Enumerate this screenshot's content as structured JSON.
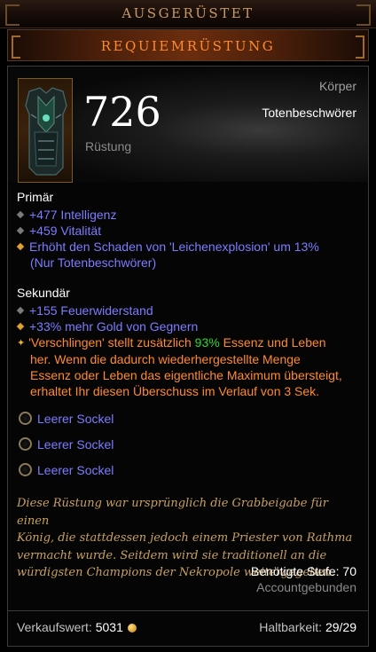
{
  "header": {
    "title": "AUSGERÜSTET"
  },
  "item": {
    "name": "REQUIEMRÜSTUNG",
    "armor_value": "726",
    "armor_label": "Rüstung",
    "slot": "Körper",
    "class": "Totenbeschwörer"
  },
  "primary": {
    "title": "Primär",
    "stats": [
      {
        "text": "+477 Intelligenz"
      },
      {
        "text": "+459 Vitalität"
      },
      {
        "line1": "Erhöht den Schaden von 'Leichenexplosion' um 13%",
        "line2": "(Nur Totenbeschwörer)"
      }
    ]
  },
  "secondary": {
    "title": "Sekundär",
    "stats": [
      {
        "text": "+155 Feuerwiderstand"
      },
      {
        "text": "+33% mehr Gold von Gegnern"
      },
      {
        "pre": "'Verschlingen' stellt zusätzlich ",
        "highlight": "93%",
        "post": " Essenz und Leben",
        "line2": "her. Wenn die dadurch wiederhergestellte Menge",
        "line3": "Essenz oder Leben das eigentliche Maximum übersteigt,",
        "line4": "erhaltet Ihr diesen Überschuss im Verlauf von 3 Sek."
      }
    ]
  },
  "sockets": [
    "Leerer Sockel",
    "Leerer Sockel",
    "Leerer Sockel"
  ],
  "flavor": {
    "line1": "Diese Rüstung war ursprünglich die Grabbeigabe für einen",
    "line2": "König, die stattdessen jedoch einem Priester von Rathma",
    "line3": "vermacht wurde. Seitdem wird sie traditionell an die",
    "line4": "würdigsten Champions der Nekropole weitergegeben."
  },
  "requirements": {
    "level": "Benötigte Stufe: 70",
    "binding": "Accountgebunden"
  },
  "footer": {
    "sell_label": "Verkaufswert:",
    "sell_value": "5031",
    "durability_label": "Haltbarkeit:",
    "durability_value": "29/29"
  },
  "colors": {
    "legendary": "#ff8a2c",
    "magic": "#7c7cff",
    "highlight": "#22dd22",
    "flavor": "#c8a060"
  },
  "icons": {
    "socket": "empty-socket-icon",
    "gold": "gold-coin-icon",
    "item": "chest-armor-icon"
  }
}
